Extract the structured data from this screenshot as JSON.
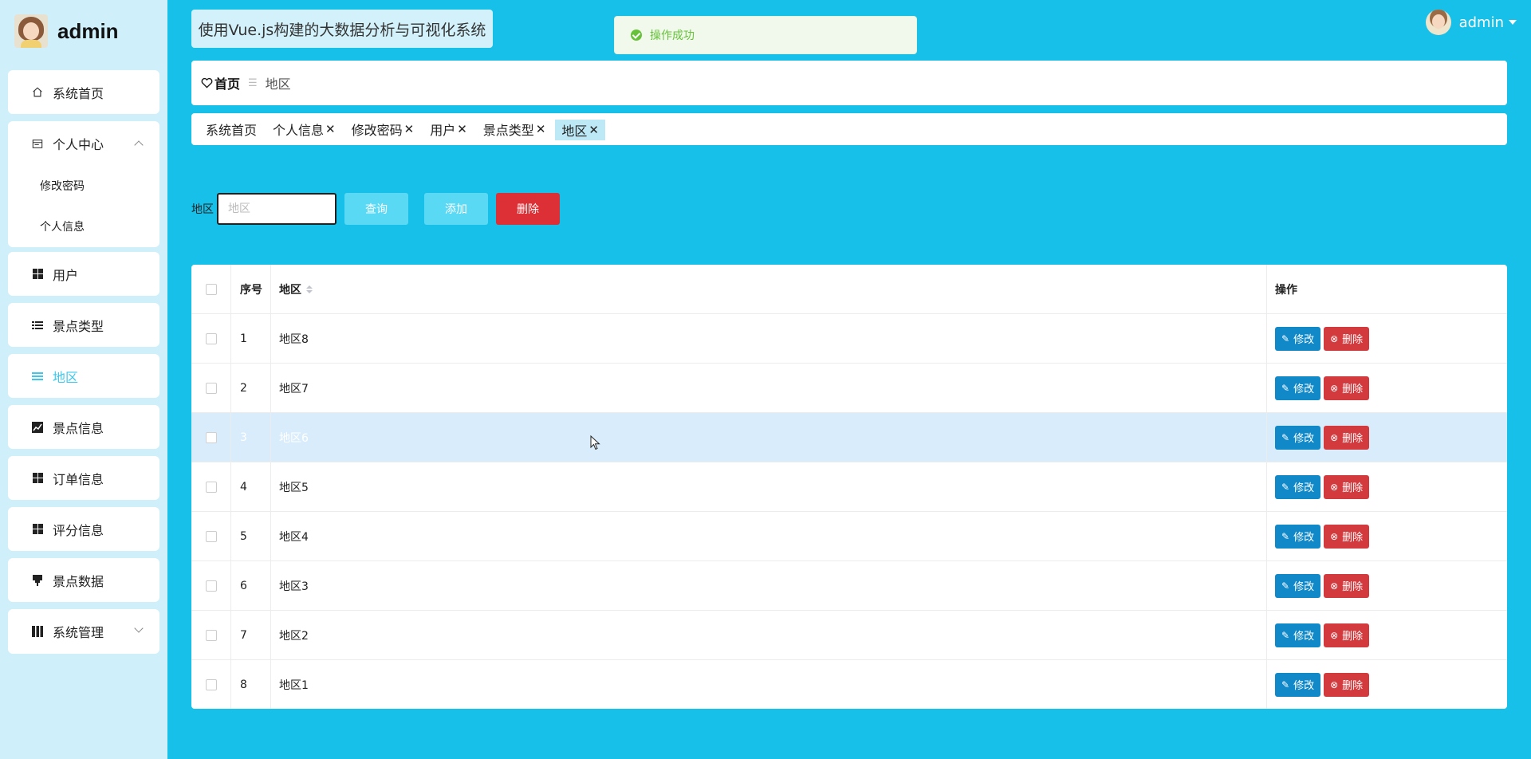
{
  "sidebar": {
    "brand": "admin",
    "items": [
      {
        "label": "系统首页",
        "icon": "home-icon"
      },
      {
        "label": "个人中心",
        "icon": "calendar-icon",
        "expanded": true,
        "children": [
          {
            "label": "修改密码"
          },
          {
            "label": "个人信息"
          }
        ]
      },
      {
        "label": "用户",
        "icon": "grid-icon"
      },
      {
        "label": "景点类型",
        "icon": "list-icon"
      },
      {
        "label": "地区",
        "icon": "list-icon",
        "active": true
      },
      {
        "label": "景点信息",
        "icon": "chart-icon"
      },
      {
        "label": "订单信息",
        "icon": "grid-icon"
      },
      {
        "label": "评分信息",
        "icon": "grid-icon"
      },
      {
        "label": "景点数据",
        "icon": "pin-icon"
      },
      {
        "label": "系统管理",
        "icon": "book-icon",
        "expanded": false
      }
    ]
  },
  "header": {
    "title": "使用Vue.js构建的大数据分析与可视化系统",
    "toast": "操作成功",
    "user": "admin"
  },
  "breadcrumb": {
    "home": "首页",
    "separator": "☰",
    "current": "地区"
  },
  "tabs": [
    {
      "label": "系统首页",
      "closable": false
    },
    {
      "label": "个人信息",
      "closable": true
    },
    {
      "label": "修改密码",
      "closable": true
    },
    {
      "label": "用户",
      "closable": true
    },
    {
      "label": "景点类型",
      "closable": true
    },
    {
      "label": "地区",
      "closable": true,
      "active": true
    }
  ],
  "search": {
    "label": "地区",
    "placeholder": "地区",
    "query_label": "查询",
    "add_label": "添加",
    "delete_label": "删除"
  },
  "table": {
    "columns": [
      "序号",
      "地区",
      "操作"
    ],
    "edit_label": "修改",
    "delete_label": "删除",
    "rows": [
      {
        "idx": "1",
        "area": "地区8"
      },
      {
        "idx": "2",
        "area": "地区7"
      },
      {
        "idx": "3",
        "area": "地区6",
        "hovered": true
      },
      {
        "idx": "4",
        "area": "地区5"
      },
      {
        "idx": "5",
        "area": "地区4"
      },
      {
        "idx": "6",
        "area": "地区3"
      },
      {
        "idx": "7",
        "area": "地区2"
      },
      {
        "idx": "8",
        "area": "地区1"
      }
    ]
  },
  "colors": {
    "background": "#17c0e9",
    "sidebar": "#cfeffa",
    "active_menu": "#3fc6ea",
    "edit_button": "#1189c9",
    "delete_button": "#d33a3e",
    "toast_text": "#67c23a"
  }
}
